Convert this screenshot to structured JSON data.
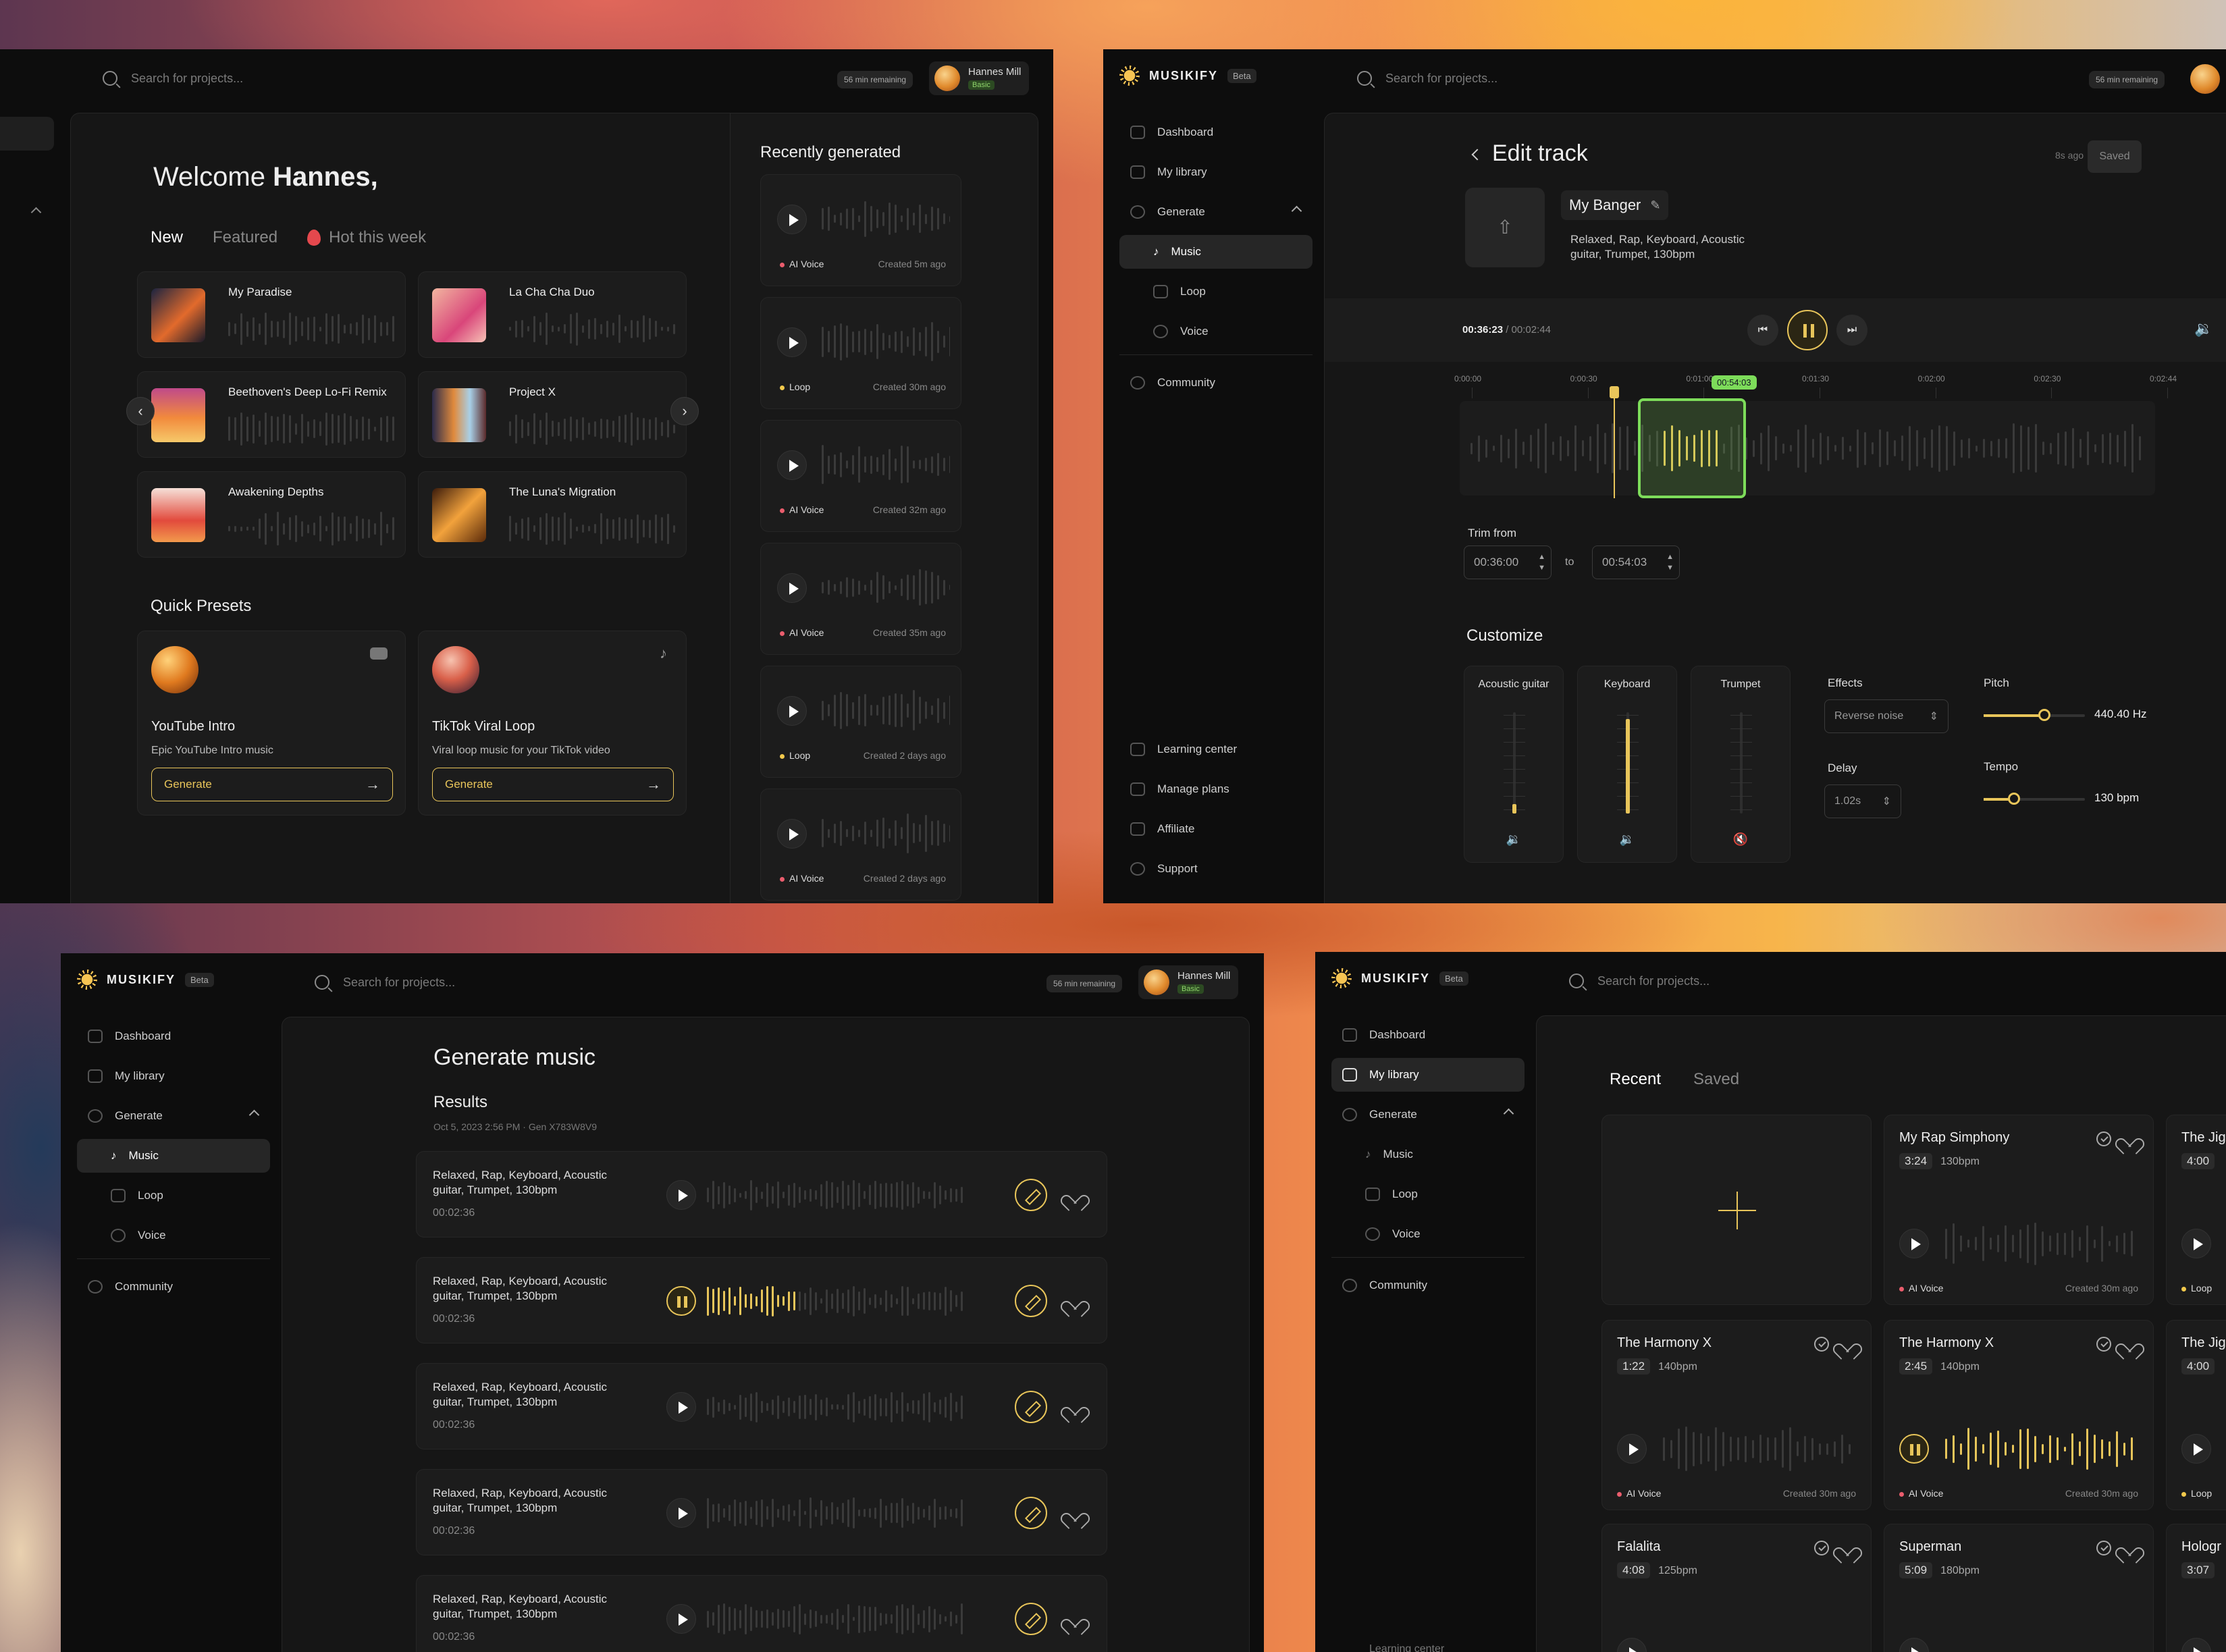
{
  "search_placeholder": "Search for projects...",
  "remaining": "56 min remaining",
  "user": {
    "name": "Hannes Mill",
    "plan": "Basic"
  },
  "brand": {
    "name": "MUSIKIFY",
    "badge": "Beta"
  },
  "nav": {
    "dashboard": "Dashboard",
    "library": "My library",
    "generate": "Generate",
    "music": "Music",
    "loop": "Loop",
    "voice": "Voice",
    "community": "Community",
    "learning": "Learning center",
    "plans": "Manage plans",
    "affiliate": "Affiliate",
    "support": "Support"
  },
  "dashboard": {
    "welcome": "Welcome",
    "name": "Hannes,",
    "tabs": [
      "New",
      "Featured",
      "Hot this week"
    ],
    "tracks": [
      "My Paradise",
      "La Cha Cha Duo",
      "Beethoven's Deep Lo-Fi Remix",
      "Project X",
      "Awakening Depths",
      "The Luna's Migration"
    ],
    "presets_title": "Quick Presets",
    "presets": [
      {
        "title": "YouTube Intro",
        "desc": "Epic YouTube Intro music",
        "btn": "Generate"
      },
      {
        "title": "TikTok Viral Loop",
        "desc": "Viral loop music for your TikTok video",
        "btn": "Generate"
      }
    ],
    "recent_title": "Recently generated",
    "recent": [
      {
        "type": "AI Voice",
        "time": "Created 5m ago"
      },
      {
        "type": "Loop",
        "time": "Created 30m ago"
      },
      {
        "type": "AI Voice",
        "time": "Created 32m ago"
      },
      {
        "type": "AI Voice",
        "time": "Created 35m ago"
      },
      {
        "type": "Loop",
        "time": "Created 2 days ago"
      },
      {
        "type": "AI Voice",
        "time": "Created 2 days ago"
      }
    ]
  },
  "edit": {
    "title": "Edit track",
    "ago": "8s ago",
    "saved": "Saved",
    "track_name": "My Banger",
    "tags": "Relaxed, Rap, Keyboard, Acoustic guitar, Trumpet, 130bpm",
    "time_current": "00:36:23",
    "time_total": "/ 00:02:44",
    "volume": 0.42,
    "ticks": [
      "0:00:00",
      "0:00:30",
      "0:01:00",
      "0:01:30",
      "0:02:00",
      "0:02:30",
      "0:02:44"
    ],
    "marker": "00:54:03",
    "trim_label": "Trim from",
    "trim_from": "00:36:00",
    "trim_to_label": "to",
    "trim_to": "00:54:03",
    "customize": "Customize",
    "instruments": [
      {
        "name": "Acoustic guitar",
        "level": 0.1
      },
      {
        "name": "Keyboard",
        "level": 1.0
      },
      {
        "name": "Trumpet",
        "level": 0.0
      }
    ],
    "effects_label": "Effects",
    "effects_value": "Reverse noise",
    "delay_label": "Delay",
    "delay_value": "1.02s",
    "pitch_label": "Pitch",
    "pitch_value": "440.40 Hz",
    "pitch_level": 0.6,
    "tempo_label": "Tempo",
    "tempo_value": "130 bpm",
    "tempo_level": 0.3
  },
  "generate": {
    "title": "Generate music",
    "results": "Results",
    "meta": "Oct 5, 2023 2:56 PM · Gen X783W8V9",
    "rows": [
      {
        "tags": "Relaxed, Rap, Keyboard, Acoustic guitar, Trumpet, 130bpm",
        "dur": "00:02:36"
      },
      {
        "tags": "Relaxed, Rap, Keyboard, Acoustic guitar, Trumpet, 130bpm",
        "dur": "00:02:36"
      },
      {
        "tags": "Relaxed, Rap, Keyboard, Acoustic guitar, Trumpet, 130bpm",
        "dur": "00:02:36"
      },
      {
        "tags": "Relaxed, Rap, Keyboard, Acoustic guitar, Trumpet, 130bpm",
        "dur": "00:02:36"
      },
      {
        "tags": "Relaxed, Rap, Keyboard, Acoustic guitar, Trumpet, 130bpm",
        "dur": "00:02:36"
      }
    ]
  },
  "library": {
    "tabs": [
      "Recent",
      "Saved"
    ],
    "cards": [
      {
        "title": "My Rap Simphony",
        "dur": "3:24",
        "bpm": "130bpm",
        "type": "AI Voice",
        "time": "Created 30m ago"
      },
      {
        "title": "The Jig",
        "dur": "4:00",
        "bpm": "",
        "type": "Loop",
        "time": ""
      },
      {
        "title": "The Harmony X",
        "dur": "1:22",
        "bpm": "140bpm",
        "type": "AI Voice",
        "time": "Created 30m ago"
      },
      {
        "title": "The Harmony X",
        "dur": "2:45",
        "bpm": "140bpm",
        "type": "AI Voice",
        "time": "Created 30m ago"
      },
      {
        "title": "The Jig",
        "dur": "4:00",
        "bpm": "",
        "type": "Loop",
        "time": ""
      },
      {
        "title": "Falalita",
        "dur": "4:08",
        "bpm": "125bpm"
      },
      {
        "title": "Superman",
        "dur": "5:09",
        "bpm": "180bpm"
      },
      {
        "title": "Hologr",
        "dur": "3:07",
        "bpm": ""
      }
    ]
  }
}
